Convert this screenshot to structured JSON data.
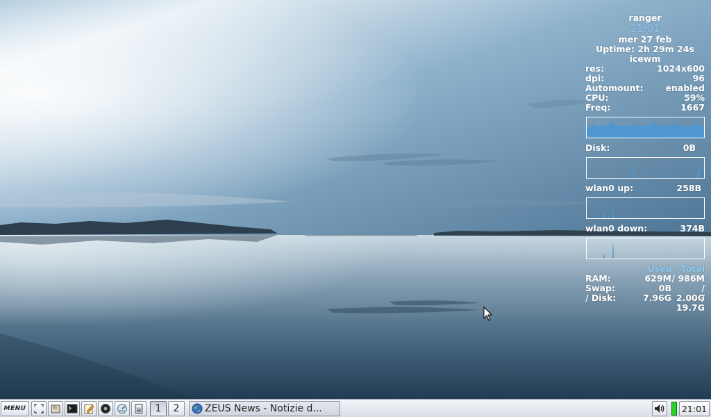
{
  "conky": {
    "hostname": "ranger",
    "time": "21:01",
    "date": "mer 27 feb",
    "uptime": "Uptime: 2h 29m 24s",
    "wm": "icewm",
    "stats": [
      {
        "label": "res:",
        "value": "1024x600"
      },
      {
        "label": "dpi:",
        "value": "96"
      },
      {
        "label": "Automount:",
        "value": "enabled"
      },
      {
        "label": "CPU:",
        "value": "59%"
      },
      {
        "label": "Freq:",
        "value": "1667"
      }
    ],
    "disk": {
      "label": "Disk:",
      "value": "0B"
    },
    "wlan_up": {
      "label": "wlan0 up:",
      "value": "258B"
    },
    "wlan_down": {
      "label": "wlan0 down:",
      "value": "374B"
    },
    "mem_header": "Used / Total",
    "mem": [
      {
        "label": "RAM:",
        "used": "629M",
        "total": "/ 986M"
      },
      {
        "label": "Swap:",
        "used": "0B",
        "total": "/ 2.00G"
      },
      {
        "label": "/ Disk:",
        "used": "7.96G",
        "total": "/ 19.7G"
      }
    ],
    "accent_color": "#8ec7f0",
    "graph_color": "#4f97d1"
  },
  "taskbar": {
    "menu_label": "MENU",
    "quick_launch": [
      "show-desktop-icon",
      "files-icon",
      "terminal-icon",
      "editor-icon",
      "media-icon",
      "browser-icon",
      "calculator-icon"
    ],
    "workspaces": [
      "1",
      "2"
    ],
    "active_workspace": "1",
    "task_title": "ZEUS News - Notizie d...",
    "clock": "21:01",
    "network_color": "#28d228"
  }
}
